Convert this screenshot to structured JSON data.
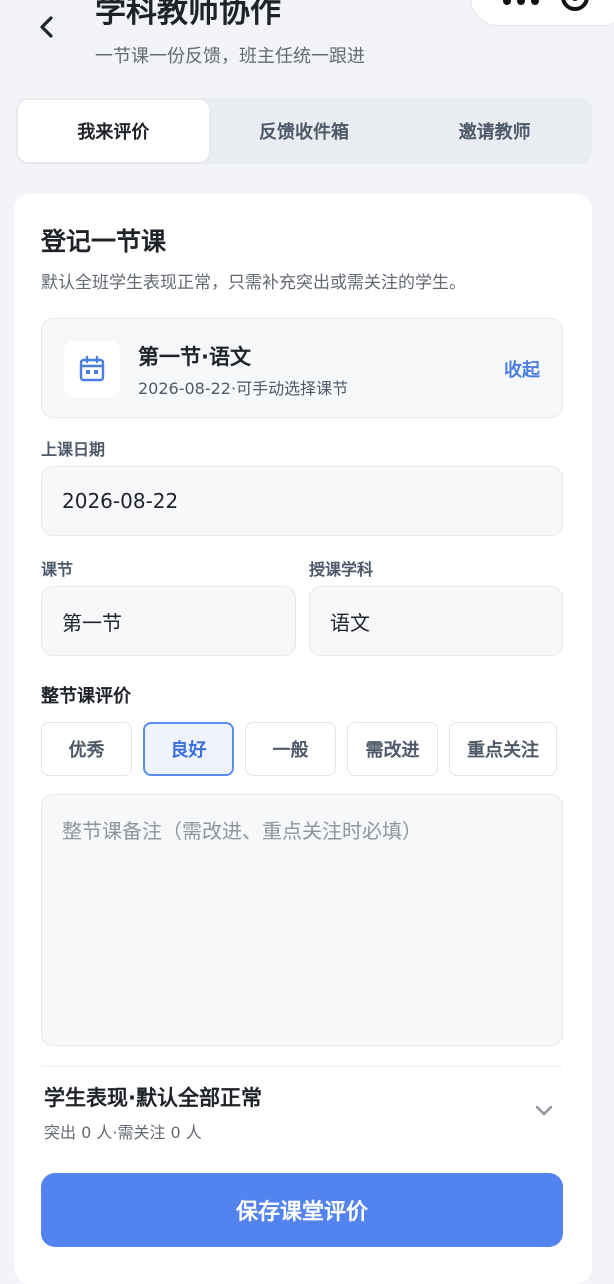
{
  "header": {
    "title": "学科教师协作",
    "subtitle": "一节课一份反馈，班主任统一跟进",
    "back_icon": "chevron-left-icon"
  },
  "tabs": [
    {
      "label": "我来评价",
      "active": true
    },
    {
      "label": "反馈收件箱",
      "active": false
    },
    {
      "label": "邀请教师",
      "active": false
    }
  ],
  "form": {
    "title": "登记一节课",
    "description": "默认全班学生表现正常，只需补充突出或需关注的学生。",
    "lesson": {
      "icon": "calendar-icon",
      "name": "第一节·语文",
      "meta": "2026-08-22·可手动选择课节",
      "collapse_label": "收起"
    },
    "date": {
      "label": "上课日期",
      "value": "2026-08-22"
    },
    "period": {
      "label": "课节",
      "value": "第一节"
    },
    "subject": {
      "label": "授课学科",
      "value": "语文"
    },
    "rating": {
      "label": "整节课评价",
      "options": [
        "优秀",
        "良好",
        "一般",
        "需改进",
        "重点关注"
      ],
      "selected": "良好"
    },
    "note": {
      "placeholder": "整节课备注（需改进、重点关注时必填）",
      "value": ""
    },
    "performance": {
      "title": "学生表现·默认全部正常",
      "summary": "突出 0 人·需关注 0 人",
      "icon": "chevron-down-icon"
    },
    "save_label": "保存课堂评价"
  },
  "colors": {
    "accent": "#5383ee",
    "link": "#4a7fe0",
    "selected_border": "#5b8def",
    "background": "#f2f4f7"
  }
}
